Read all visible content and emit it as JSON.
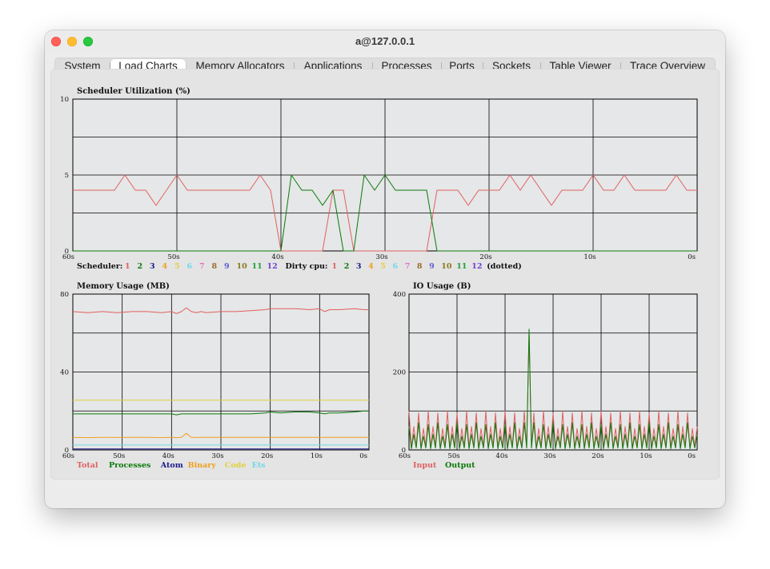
{
  "window": {
    "title": "a@127.0.0.1"
  },
  "tabs": [
    {
      "label": "System",
      "active": false
    },
    {
      "label": "Load Charts",
      "active": true
    },
    {
      "label": "Memory Allocators",
      "active": false
    },
    {
      "label": "Applications",
      "active": false
    },
    {
      "label": "Processes",
      "active": false
    },
    {
      "label": "Ports",
      "active": false
    },
    {
      "label": "Sockets",
      "active": false
    },
    {
      "label": "Table Viewer",
      "active": false
    },
    {
      "label": "Trace Overview",
      "active": false
    }
  ],
  "chart_data": [
    {
      "type": "line",
      "title": "Scheduler Utilization (%)",
      "x": [
        60,
        58,
        56,
        55,
        54,
        53,
        52,
        51,
        50,
        49,
        48,
        47,
        46,
        45,
        44,
        43,
        42,
        41,
        40,
        39,
        38,
        37,
        36,
        35,
        34,
        33,
        32,
        31,
        30,
        29,
        28,
        27,
        26,
        25,
        24,
        23,
        22,
        21,
        20,
        19,
        18,
        17,
        16,
        15,
        14,
        13,
        12,
        11,
        10,
        9,
        8,
        7,
        6,
        5,
        4,
        3,
        2,
        1,
        0
      ],
      "series": [
        {
          "name": "1",
          "color": "#e06060",
          "values": [
            4,
            4,
            4,
            5,
            4,
            4,
            3,
            4,
            5,
            4,
            4,
            4,
            4,
            4,
            4,
            4,
            5,
            4,
            0,
            0,
            0,
            0,
            0,
            4,
            4,
            0,
            0,
            0,
            0,
            0,
            0,
            0,
            0,
            4,
            4,
            4,
            3,
            4,
            4,
            4,
            5,
            4,
            5,
            4,
            3,
            4,
            4,
            4,
            5,
            4,
            4,
            5,
            4,
            4,
            4,
            4,
            5,
            4,
            4
          ]
        },
        {
          "name": "2",
          "color": "#0a7a0a",
          "values": [
            0,
            0,
            0,
            0,
            0,
            0,
            0,
            0,
            0,
            0,
            0,
            0,
            0,
            0,
            0,
            0,
            0,
            0,
            0,
            5,
            4,
            4,
            3,
            4,
            0,
            0,
            5,
            4,
            5,
            4,
            4,
            4,
            4,
            0,
            0,
            0,
            0,
            0,
            0,
            0,
            0,
            0,
            0,
            0,
            0,
            0,
            0,
            0,
            0,
            0,
            0,
            0,
            0,
            0,
            0,
            0,
            0,
            0,
            0
          ]
        }
      ],
      "ylim": [
        0,
        10
      ],
      "yticks": [
        "0",
        "5",
        "10"
      ],
      "xticks": [
        "60s",
        "50s",
        "40s",
        "30s",
        "20s",
        "10s",
        "0s"
      ],
      "grid": true,
      "legend_prefix": "Scheduler:",
      "legend": [
        {
          "label": "1",
          "color": "#e06060"
        },
        {
          "label": "2",
          "color": "#0a7a0a"
        },
        {
          "label": "3",
          "color": "#1a1a8a"
        },
        {
          "label": "4",
          "color": "#f0a020"
        },
        {
          "label": "5",
          "color": "#e0d040"
        },
        {
          "label": "6",
          "color": "#70d8e8"
        },
        {
          "label": "7",
          "color": "#e070c0"
        },
        {
          "label": "8",
          "color": "#9a6a2a"
        },
        {
          "label": "9",
          "color": "#6060d0"
        },
        {
          "label": "10",
          "color": "#8a7a20"
        },
        {
          "label": "11",
          "color": "#20a040"
        },
        {
          "label": "12",
          "color": "#7040d0"
        }
      ],
      "dirty_prefix": "Dirty cpu:",
      "dirty_legend": [
        {
          "label": "1",
          "color": "#e06060"
        },
        {
          "label": "2",
          "color": "#0a7a0a"
        },
        {
          "label": "3",
          "color": "#1a1a8a"
        },
        {
          "label": "4",
          "color": "#f0a020"
        },
        {
          "label": "5",
          "color": "#e0d040"
        },
        {
          "label": "6",
          "color": "#70d8e8"
        },
        {
          "label": "7",
          "color": "#e070c0"
        },
        {
          "label": "8",
          "color": "#9a6a2a"
        },
        {
          "label": "9",
          "color": "#6060d0"
        },
        {
          "label": "10",
          "color": "#8a7a20"
        },
        {
          "label": "11",
          "color": "#20a040"
        },
        {
          "label": "12",
          "color": "#7040d0"
        }
      ],
      "dirty_suffix": "(dotted)"
    },
    {
      "type": "line",
      "title": "Memory Usage (MB)",
      "x": [
        60,
        57,
        54,
        51,
        48,
        45,
        42,
        40,
        39,
        38,
        37,
        36,
        35,
        34,
        33,
        30,
        27,
        24,
        21,
        20,
        18,
        15,
        12,
        10,
        9,
        8,
        6,
        3,
        1,
        0
      ],
      "series": [
        {
          "name": "Total",
          "color": "#e06060",
          "values": [
            71,
            70.5,
            71,
            70.5,
            71,
            71,
            70.5,
            71,
            70,
            71,
            73,
            71,
            70.5,
            71,
            70.5,
            71,
            71,
            71.5,
            72,
            72.5,
            72.5,
            72.5,
            72,
            72.5,
            71,
            72,
            72,
            72.5,
            72,
            72
          ]
        },
        {
          "name": "Processes",
          "color": "#0a7a0a",
          "values": [
            18.5,
            18.5,
            18.5,
            18.5,
            18.5,
            18.5,
            18.5,
            18.5,
            18,
            18.5,
            18.5,
            18.5,
            18.5,
            18.5,
            18.5,
            18.5,
            18.5,
            18.5,
            19,
            19.5,
            19,
            19.5,
            19.5,
            19,
            18.5,
            19,
            19,
            19.5,
            20,
            20
          ]
        },
        {
          "name": "Atom",
          "color": "#1a1a8a",
          "values": [
            0.5,
            0.5,
            0.5,
            0.5,
            0.5,
            0.5,
            0.5,
            0.5,
            0.5,
            0.5,
            0.5,
            0.5,
            0.5,
            0.5,
            0.5,
            0.5,
            0.5,
            0.5,
            0.5,
            0.5,
            0.5,
            0.5,
            0.5,
            0.5,
            0.5,
            0.5,
            0.5,
            0.5,
            0.5,
            0.5
          ]
        },
        {
          "name": "Binary",
          "color": "#f0a020",
          "values": [
            6.5,
            6.3,
            6.5,
            6.4,
            6.5,
            6.5,
            6.3,
            6.5,
            6.3,
            6.5,
            8.5,
            6.5,
            6.4,
            6.5,
            6.5,
            6.5,
            6.5,
            6.5,
            6.5,
            6.5,
            6.5,
            6.5,
            6.5,
            6.5,
            6.5,
            6.5,
            6.5,
            6.5,
            6.5,
            6.5
          ]
        },
        {
          "name": "Code",
          "color": "#e0d040",
          "values": [
            25.5,
            25.5,
            25.5,
            25.5,
            25.5,
            25.5,
            25.5,
            25.5,
            25.5,
            25.5,
            25.5,
            25.5,
            25.5,
            25.5,
            25.5,
            25.5,
            25.5,
            25.5,
            25.5,
            25.5,
            25.5,
            25.5,
            25.5,
            25.5,
            25.5,
            25.5,
            25.5,
            25.5,
            25.5,
            25.5
          ]
        },
        {
          "name": "Ets",
          "color": "#70d8e8",
          "values": [
            2.5,
            2.5,
            2.5,
            2.5,
            2.5,
            2.5,
            2.5,
            2.5,
            2.5,
            2.5,
            2.5,
            2.5,
            2.5,
            2.5,
            2.5,
            2.5,
            2.5,
            2.5,
            2.5,
            2.5,
            2.5,
            2.5,
            2.5,
            2.5,
            2.5,
            2.5,
            2.5,
            2.5,
            2.5,
            2.5
          ]
        }
      ],
      "ylim": [
        0,
        80
      ],
      "yticks": [
        "0",
        "40",
        "80"
      ],
      "xticks": [
        "60s",
        "50s",
        "40s",
        "30s",
        "20s",
        "10s",
        "0s"
      ],
      "grid": true,
      "legend": [
        {
          "label": "Total",
          "color": "#e06060"
        },
        {
          "label": "Processes",
          "color": "#0a7a0a"
        },
        {
          "label": "Atom",
          "color": "#1a1a8a"
        },
        {
          "label": "Binary",
          "color": "#f0a020"
        },
        {
          "label": "Code",
          "color": "#e0d040"
        },
        {
          "label": "Ets",
          "color": "#70d8e8"
        }
      ]
    },
    {
      "type": "line",
      "title": "IO Usage (B)",
      "x": [
        60,
        59.5,
        59,
        58.5,
        58,
        57.5,
        57,
        56.5,
        56,
        55.5,
        55,
        54.5,
        54,
        53.5,
        53,
        52.5,
        52,
        51.5,
        51,
        50.5,
        50,
        49.5,
        49,
        48.5,
        48,
        47.5,
        47,
        46.5,
        46,
        45.5,
        45,
        44.5,
        44,
        43.5,
        43,
        42.5,
        42,
        41.5,
        41,
        40.5,
        40,
        39.5,
        39,
        38.5,
        38,
        37.5,
        37,
        36.5,
        36,
        35.5,
        35,
        34.5,
        34,
        33.5,
        33,
        32.5,
        32,
        31.5,
        31,
        30.5,
        30,
        29.5,
        29,
        28.5,
        28,
        27.5,
        27,
        26.5,
        26,
        25.5,
        25,
        24.5,
        24,
        23.5,
        23,
        22.5,
        22,
        21.5,
        21,
        20.5,
        20,
        19.5,
        19,
        18.5,
        18,
        17.5,
        17,
        16.5,
        16,
        15.5,
        15,
        14.5,
        14,
        13.5,
        13,
        12.5,
        12,
        11.5,
        11,
        10.5,
        10,
        9.5,
        9,
        8.5,
        8,
        7.5,
        7,
        6.5,
        6,
        5.5,
        5,
        4.5,
        4,
        3.5,
        3,
        2.5,
        2,
        1.5,
        1,
        0.5,
        0
      ],
      "series": [
        {
          "name": "Input",
          "color": "#e06060",
          "values": [
            100,
            5,
            60,
            8,
            95,
            5,
            55,
            8,
            100,
            5,
            60,
            8,
            95,
            5,
            55,
            8,
            100,
            5,
            60,
            8,
            95,
            5,
            55,
            8,
            100,
            5,
            60,
            8,
            95,
            5,
            55,
            8,
            100,
            5,
            60,
            8,
            95,
            5,
            55,
            8,
            100,
            5,
            60,
            8,
            95,
            5,
            55,
            8,
            100,
            5,
            300,
            8,
            95,
            5,
            55,
            8,
            100,
            5,
            60,
            8,
            95,
            5,
            55,
            8,
            100,
            5,
            60,
            8,
            95,
            5,
            55,
            8,
            100,
            5,
            60,
            8,
            95,
            5,
            55,
            8,
            100,
            5,
            60,
            8,
            95,
            5,
            55,
            8,
            100,
            5,
            60,
            8,
            95,
            5,
            55,
            8,
            100,
            5,
            60,
            8,
            95,
            5,
            55,
            8,
            100,
            5,
            60,
            8,
            95,
            5,
            55,
            8,
            100,
            5,
            60,
            8,
            95,
            5,
            55,
            8,
            60
          ]
        },
        {
          "name": "Output",
          "color": "#0a7a0a",
          "values": [
            60,
            3,
            40,
            5,
            70,
            3,
            35,
            5,
            65,
            3,
            40,
            5,
            70,
            3,
            35,
            5,
            65,
            3,
            40,
            5,
            70,
            3,
            35,
            5,
            65,
            3,
            40,
            5,
            70,
            3,
            35,
            5,
            65,
            3,
            40,
            5,
            70,
            3,
            35,
            5,
            65,
            3,
            40,
            5,
            70,
            3,
            35,
            5,
            70,
            5,
            310,
            5,
            70,
            3,
            35,
            5,
            65,
            3,
            40,
            5,
            70,
            3,
            35,
            5,
            65,
            3,
            40,
            5,
            70,
            3,
            35,
            5,
            65,
            3,
            40,
            5,
            70,
            3,
            35,
            5,
            65,
            3,
            40,
            5,
            70,
            3,
            35,
            5,
            65,
            3,
            40,
            5,
            70,
            3,
            35,
            5,
            65,
            3,
            40,
            5,
            70,
            3,
            35,
            5,
            65,
            3,
            40,
            5,
            70,
            3,
            35,
            5,
            65,
            3,
            40,
            5,
            70,
            3,
            35,
            5,
            40
          ]
        }
      ],
      "ylim": [
        0,
        400
      ],
      "yticks": [
        "0",
        "200",
        "400"
      ],
      "xticks": [
        "60s",
        "50s",
        "40s",
        "30s",
        "20s",
        "10s",
        "0s"
      ],
      "grid": true,
      "legend": [
        {
          "label": "Input",
          "color": "#e06060"
        },
        {
          "label": "Output",
          "color": "#0a7a0a"
        }
      ]
    }
  ]
}
